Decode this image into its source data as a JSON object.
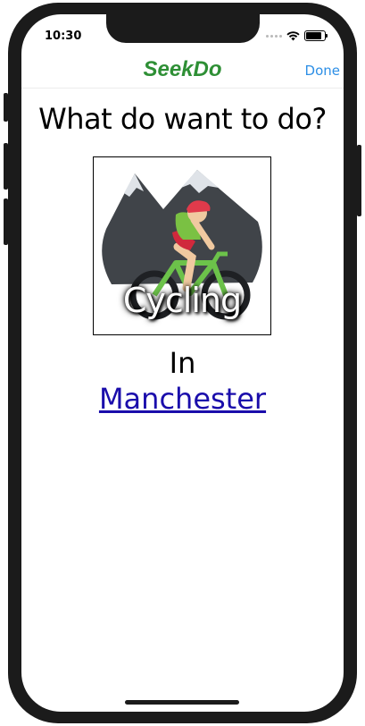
{
  "status": {
    "time": "10:30"
  },
  "nav": {
    "title": "SeekDo",
    "done": "Done"
  },
  "main": {
    "question": "What do want to do?",
    "activity": {
      "label": "Cycling",
      "icon": "cyclist-mountains-icon"
    },
    "in_label": "In",
    "location": "Manchester"
  },
  "colors": {
    "brand": "#2e8f35",
    "link": "#1a0dab",
    "done": "#2d8fe6"
  }
}
